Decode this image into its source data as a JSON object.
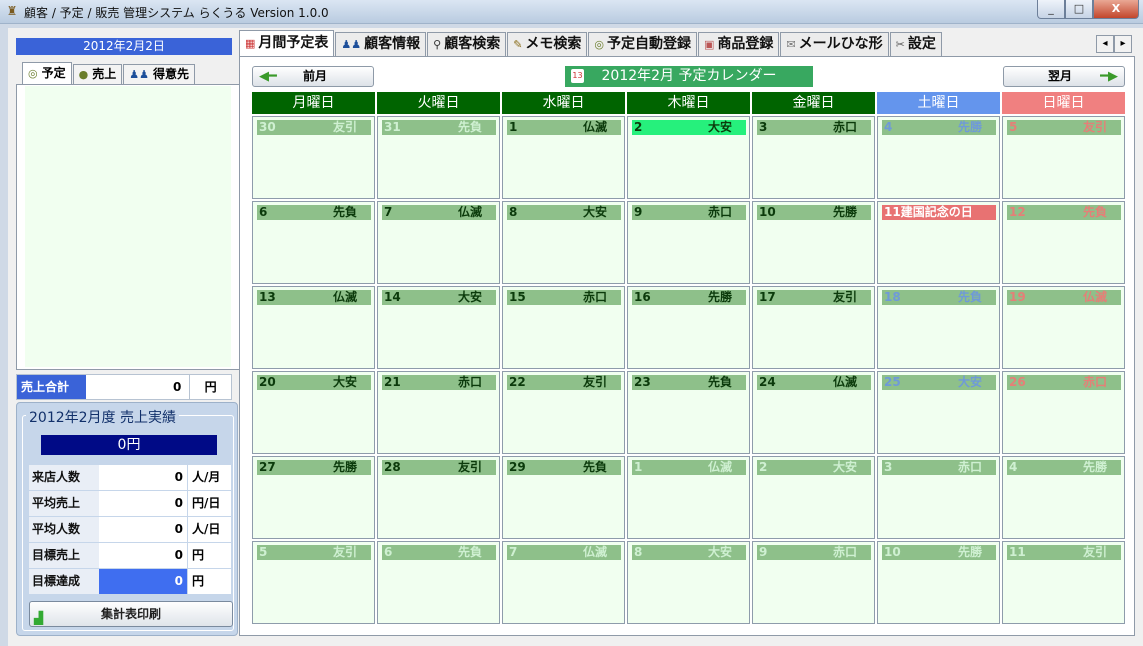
{
  "window": {
    "title": "顧客 / 予定 / 販売 管理システム らくうる  Version 1.0.0",
    "btn_min": "_",
    "btn_max": "□",
    "btn_close": "X"
  },
  "left": {
    "date": "2012年2月2日",
    "tabs": [
      {
        "label": "予定",
        "icon": "clock-icon"
      },
      {
        "label": "売上",
        "icon": "money-bag-icon"
      },
      {
        "label": "得意先",
        "icon": "people-icon"
      }
    ],
    "sales_total_label": "売上合計",
    "sales_total_value": "0",
    "sales_total_unit": "円",
    "perf_title": "2012年2月度  売上実績",
    "perf_amount": "0円",
    "perf_rows": [
      {
        "label": "来店人数",
        "value": "0",
        "unit": "人/月"
      },
      {
        "label": "平均売上",
        "value": "0",
        "unit": "円/日"
      },
      {
        "label": "平均人数",
        "value": "0",
        "unit": "人/日"
      },
      {
        "label": "目標売上",
        "value": "0",
        "unit": "円"
      },
      {
        "label": "目標達成",
        "value": "0",
        "unit": "円"
      }
    ],
    "print_button": "集計表印刷"
  },
  "tabs": [
    {
      "label": "月間予定表",
      "icon": "calendar-icon"
    },
    {
      "label": "顧客情報",
      "icon": "people-icon"
    },
    {
      "label": "顧客検索",
      "icon": "magnifier-icon"
    },
    {
      "label": "メモ検索",
      "icon": "memo-icon"
    },
    {
      "label": "予定自動登録",
      "icon": "clock-icon"
    },
    {
      "label": "商品登録",
      "icon": "gift-icon"
    },
    {
      "label": "メールひな形",
      "icon": "mail-icon"
    },
    {
      "label": "設定",
      "icon": "tools-icon"
    }
  ],
  "calendar": {
    "prev_label": "前月",
    "next_label": "翌月",
    "title": "2012年2月  予定カレンダー",
    "title_icon_text": "13",
    "colors": {
      "weekday_header": "#006400",
      "saturday_header": "#6495ed",
      "sunday_header": "#f08080"
    },
    "day_headers": [
      "月曜日",
      "火曜日",
      "水曜日",
      "木曜日",
      "金曜日",
      "土曜日",
      "日曜日"
    ],
    "weeks": [
      [
        {
          "day": "30",
          "rokuyo": "友引",
          "kind": "oth"
        },
        {
          "day": "31",
          "rokuyo": "先負",
          "kind": "oth"
        },
        {
          "day": "1",
          "rokuyo": "仏滅",
          "kind": "wd"
        },
        {
          "day": "2",
          "rokuyo": "大安",
          "kind": "today"
        },
        {
          "day": "3",
          "rokuyo": "赤口",
          "kind": "wd"
        },
        {
          "day": "4",
          "rokuyo": "先勝",
          "kind": "sat"
        },
        {
          "day": "5",
          "rokuyo": "友引",
          "kind": "sun"
        }
      ],
      [
        {
          "day": "6",
          "rokuyo": "先負",
          "kind": "wd"
        },
        {
          "day": "7",
          "rokuyo": "仏滅",
          "kind": "wd"
        },
        {
          "day": "8",
          "rokuyo": "大安",
          "kind": "wd"
        },
        {
          "day": "9",
          "rokuyo": "赤口",
          "kind": "wd"
        },
        {
          "day": "10",
          "rokuyo": "先勝",
          "kind": "wd"
        },
        {
          "day": "11建国記念の日",
          "rokuyo": "",
          "kind": "hol"
        },
        {
          "day": "12",
          "rokuyo": "先負",
          "kind": "sun"
        }
      ],
      [
        {
          "day": "13",
          "rokuyo": "仏滅",
          "kind": "wd"
        },
        {
          "day": "14",
          "rokuyo": "大安",
          "kind": "wd"
        },
        {
          "day": "15",
          "rokuyo": "赤口",
          "kind": "wd"
        },
        {
          "day": "16",
          "rokuyo": "先勝",
          "kind": "wd"
        },
        {
          "day": "17",
          "rokuyo": "友引",
          "kind": "wd"
        },
        {
          "day": "18",
          "rokuyo": "先負",
          "kind": "sat"
        },
        {
          "day": "19",
          "rokuyo": "仏滅",
          "kind": "sun"
        }
      ],
      [
        {
          "day": "20",
          "rokuyo": "大安",
          "kind": "wd"
        },
        {
          "day": "21",
          "rokuyo": "赤口",
          "kind": "wd"
        },
        {
          "day": "22",
          "rokuyo": "友引",
          "kind": "wd"
        },
        {
          "day": "23",
          "rokuyo": "先負",
          "kind": "wd"
        },
        {
          "day": "24",
          "rokuyo": "仏滅",
          "kind": "wd"
        },
        {
          "day": "25",
          "rokuyo": "大安",
          "kind": "sat"
        },
        {
          "day": "26",
          "rokuyo": "赤口",
          "kind": "sun"
        }
      ],
      [
        {
          "day": "27",
          "rokuyo": "先勝",
          "kind": "wd"
        },
        {
          "day": "28",
          "rokuyo": "友引",
          "kind": "wd"
        },
        {
          "day": "29",
          "rokuyo": "先負",
          "kind": "wd"
        },
        {
          "day": "1",
          "rokuyo": "仏滅",
          "kind": "oth"
        },
        {
          "day": "2",
          "rokuyo": "大安",
          "kind": "oth"
        },
        {
          "day": "3",
          "rokuyo": "赤口",
          "kind": "oth"
        },
        {
          "day": "4",
          "rokuyo": "先勝",
          "kind": "oth"
        }
      ],
      [
        {
          "day": "5",
          "rokuyo": "友引",
          "kind": "oth"
        },
        {
          "day": "6",
          "rokuyo": "先負",
          "kind": "oth"
        },
        {
          "day": "7",
          "rokuyo": "仏滅",
          "kind": "oth"
        },
        {
          "day": "8",
          "rokuyo": "大安",
          "kind": "oth"
        },
        {
          "day": "9",
          "rokuyo": "赤口",
          "kind": "oth"
        },
        {
          "day": "10",
          "rokuyo": "先勝",
          "kind": "oth"
        },
        {
          "day": "11",
          "rokuyo": "友引",
          "kind": "oth"
        }
      ]
    ]
  }
}
